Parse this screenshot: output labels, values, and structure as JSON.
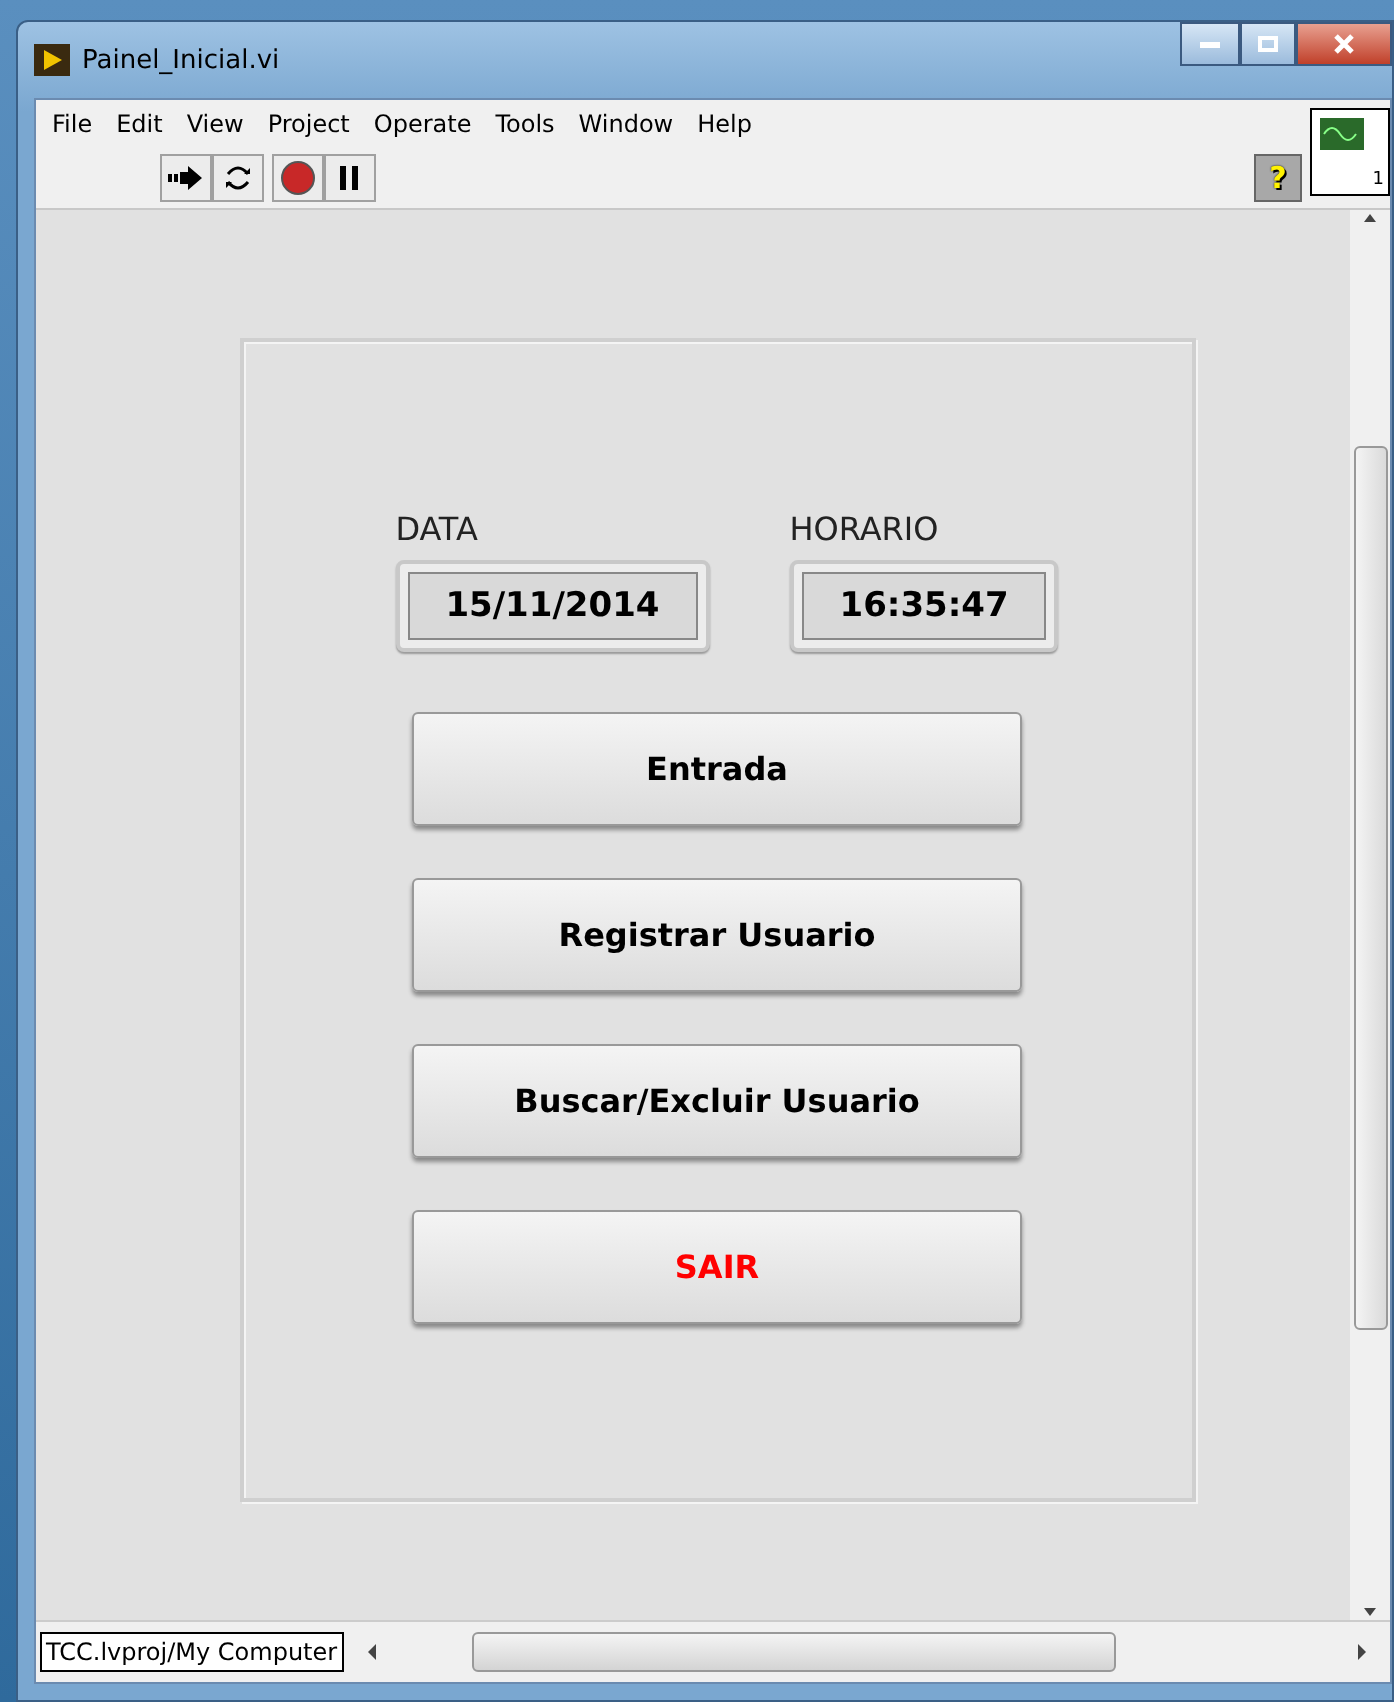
{
  "window": {
    "title": "Painel_Inicial.vi"
  },
  "menu": [
    "File",
    "Edit",
    "View",
    "Project",
    "Operate",
    "Tools",
    "Window",
    "Help"
  ],
  "toolbar": {
    "help_label": "?",
    "connector_label": "1"
  },
  "indicators": [
    {
      "label": "DATA",
      "value": "15/11/2014"
    },
    {
      "label": "HORARIO",
      "value": "16:35:47"
    }
  ],
  "buttons": [
    {
      "label": "Entrada",
      "color": "#000000"
    },
    {
      "label": "Registrar Usuario",
      "color": "#000000"
    },
    {
      "label": "Buscar/Excluir Usuario",
      "color": "#000000"
    },
    {
      "label": "SAIR",
      "color": "#ff0000"
    }
  ],
  "status_bar": {
    "context": "TCC.lvproj/My Computer"
  }
}
